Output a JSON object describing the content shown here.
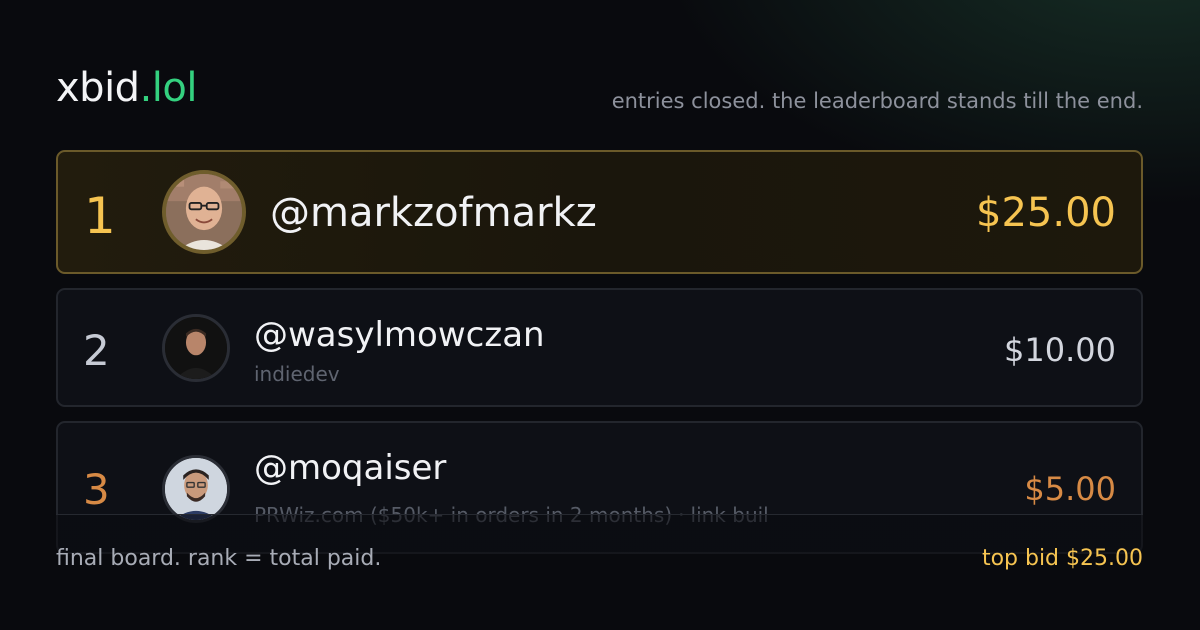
{
  "brand": {
    "name": "xbid",
    "tld": ".lol"
  },
  "tagline": "entries closed. the leaderboard stands till the end.",
  "leaderboard": [
    {
      "rank": "1",
      "handle": "@markzofmarkz",
      "subtitle": "",
      "amount": "$25.00",
      "accent": "#f6c451"
    },
    {
      "rank": "2",
      "handle": "@wasylmowczan",
      "subtitle": "indiedev",
      "amount": "$10.00",
      "accent": "#c6cad4"
    },
    {
      "rank": "3",
      "handle": "@moqaiser",
      "subtitle": "PRWiz.com ($50k+ in orders in 2 months)",
      "subtitle_more": "link buil",
      "amount": "$5.00",
      "accent": "#d78a45"
    }
  ],
  "footer": {
    "left": "final board. rank = total paid.",
    "right": "top bid $25.00"
  },
  "colors": {
    "brand_accent": "#34d17f",
    "gold": "#f6c451",
    "bronze": "#d78a45",
    "background": "#090a0e"
  }
}
